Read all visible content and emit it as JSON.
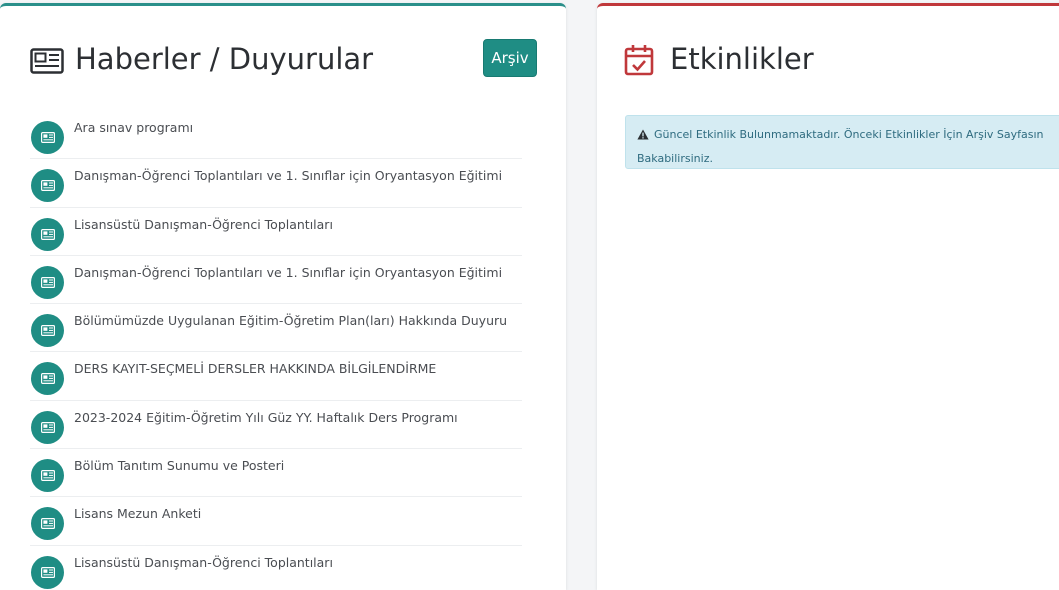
{
  "news": {
    "title": "Haberler / Duyurular",
    "icon": "newspaper-icon",
    "archive_label": "Arşiv",
    "items": [
      "Ara sınav programı",
      "Danışman-Öğrenci Toplantıları ve 1. Sınıflar için Oryantasyon Eğitimi",
      "Lisansüstü Danışman-Öğrenci Toplantıları",
      "Danışman-Öğrenci Toplantıları ve 1. Sınıflar için Oryantasyon Eğitimi",
      "Bölümümüzde Uygulanan Eğitim-Öğretim Plan(ları) Hakkında Duyuru",
      "DERS KAYIT-SEÇMELİ DERSLER HAKKINDA BİLGİLENDİRME",
      "2023-2024 Eğitim-Öğretim Yılı Güz YY. Haftalık Ders Programı",
      "Bölüm Tanıtım Sunumu ve Posteri",
      "Lisans Mezun Anketi",
      "Lisansüstü Danışman-Öğrenci Toplantıları"
    ]
  },
  "events": {
    "title": "Etkinlikler",
    "icon": "calendar-check-icon",
    "alert_line1": "Güncel Etkinlik Bulunmamaktadır. Önceki Etkinlikler İçin Arşiv Sayfasın",
    "alert_line2": "Bakabilirsiniz.",
    "alert_icon": "warning-icon"
  },
  "colors": {
    "news_accent": "#1f8d84",
    "events_accent": "#c0383b",
    "alert_bg": "#d6ecf3",
    "alert_text": "#2e6b7f"
  }
}
